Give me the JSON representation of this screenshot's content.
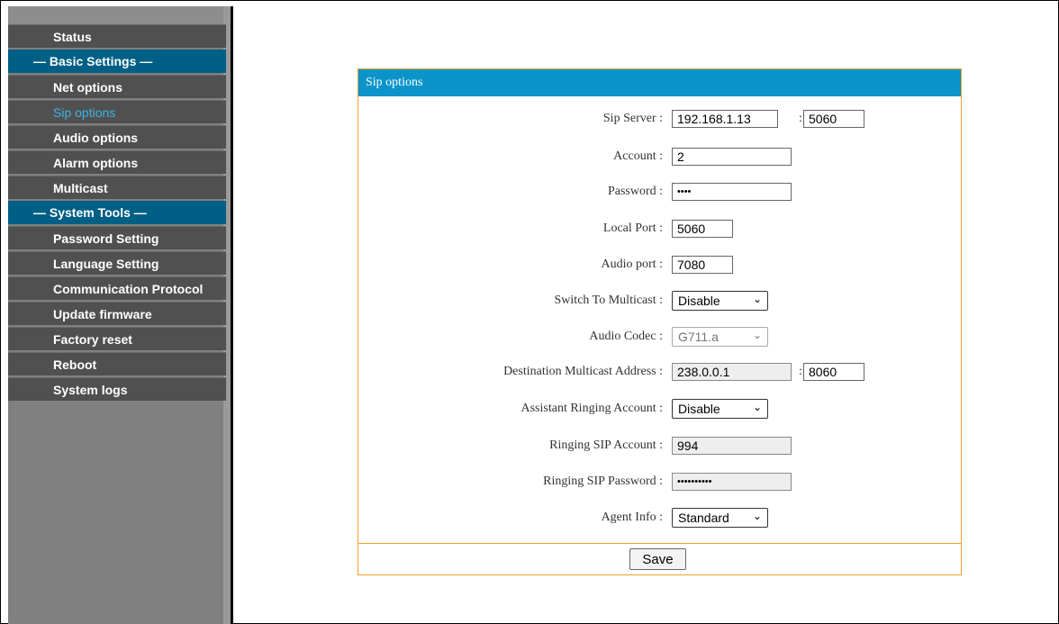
{
  "nav": {
    "status": "Status",
    "basic_header": "— Basic Settings —",
    "net": "Net options",
    "sip": "Sip options",
    "audio": "Audio options",
    "alarm": "Alarm options",
    "multicast": "Multicast",
    "tools_header": "— System Tools —",
    "password": "Password Setting",
    "language": "Language Setting",
    "protocol": "Communication Protocol",
    "firmware": "Update firmware",
    "factory": "Factory reset",
    "reboot": "Reboot",
    "logs": "System logs"
  },
  "panel": {
    "title": "Sip options",
    "sip_server_label": "Sip Server :",
    "sip_server": "192.168.1.13",
    "sip_port": "5060",
    "account_label": "Account :",
    "account": "2",
    "password_label": "Password :",
    "password": "••••",
    "local_port_label": "Local Port :",
    "local_port": "5060",
    "audio_port_label": "Audio port :",
    "audio_port": "7080",
    "switch_multicast_label": "Switch To Multicast :",
    "switch_multicast": "Disable",
    "codec_label": "Audio Codec :",
    "codec": "G711.a",
    "dest_label": "Destination Multicast Address :",
    "dest_addr": "238.0.0.1",
    "dest_port": "8060",
    "assist_label": "Assistant Ringing Account :",
    "assist": "Disable",
    "ring_acc_label": "Ringing SIP Account :",
    "ring_acc": "994",
    "ring_pwd_label": "Ringing SIP Password :",
    "ring_pwd": "••••••••••",
    "agent_label": "Agent Info :",
    "agent": "Standard",
    "colon": ":",
    "save": "Save",
    "chevron": "⌄"
  }
}
